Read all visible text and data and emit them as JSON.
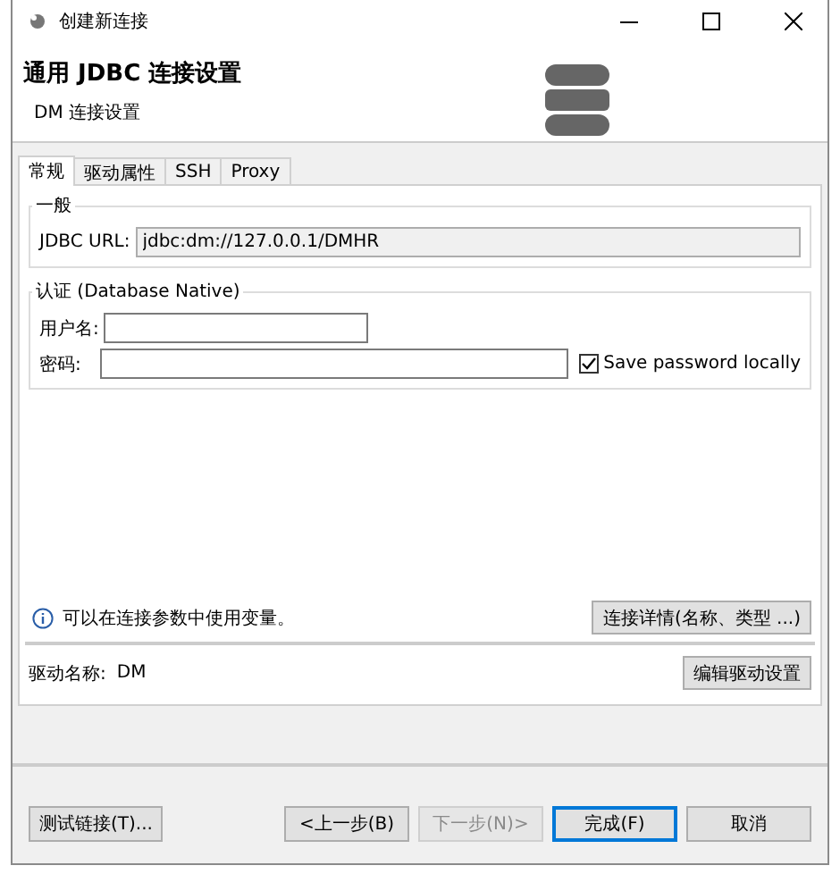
{
  "window": {
    "title": "创建新连接"
  },
  "header": {
    "title": "通用 JDBC 连接设置",
    "subtitle": "DM 连接设置"
  },
  "tabs": [
    {
      "label": "常规",
      "selected": true
    },
    {
      "label": "驱动属性",
      "selected": false
    },
    {
      "label": "SSH",
      "selected": false
    },
    {
      "label": "Proxy",
      "selected": false
    }
  ],
  "general": {
    "legend": "一般",
    "url_label": "JDBC URL:",
    "url_value": "jdbc:dm://127.0.0.1/DMHR"
  },
  "auth": {
    "legend": "认证 (Database Native)",
    "username_label": "用户名:",
    "password_label": "密码:",
    "save_password": {
      "label": "Save password locally",
      "checked": true
    }
  },
  "info": {
    "text": "可以在连接参数中使用变量。",
    "button": "连接详情(名称、类型 ...)"
  },
  "driver": {
    "label": "驱动名称:",
    "value": "DM",
    "button": "编辑驱动设置"
  },
  "footer": {
    "test_button": "测试链接(T)...",
    "buttons": [
      {
        "label": "<上一步(B)",
        "disabled": false,
        "default": false
      },
      {
        "label": "下一步(N)>",
        "disabled": true,
        "default": false
      },
      {
        "label": "完成(F)",
        "disabled": false,
        "default": true
      },
      {
        "label": "取消",
        "disabled": false,
        "default": false
      }
    ]
  }
}
